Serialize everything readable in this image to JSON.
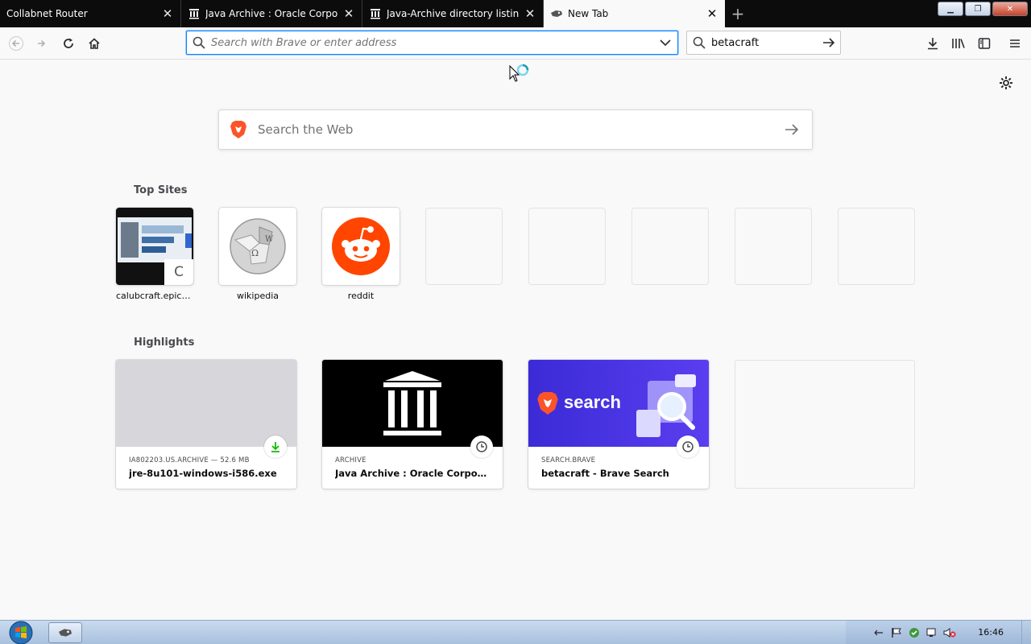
{
  "tabs": [
    {
      "title": "Collabnet Router",
      "icon": "none"
    },
    {
      "title": "Java Archive : Oracle Corporation",
      "icon": "archive-icon"
    },
    {
      "title": "Java-Archive directory listing",
      "icon": "archive-icon"
    },
    {
      "title": "New Tab",
      "icon": "brave-lion-icon"
    }
  ],
  "toolbar": {
    "url_placeholder": "Search with Brave or enter address",
    "search_value": "betacraft"
  },
  "newtab": {
    "websearch_placeholder": "Search the Web",
    "top_sites_title": "Top Sites",
    "highlights_title": "Highlights",
    "top_sites": [
      {
        "label": "calubcraft.epicg..."
      },
      {
        "label": "wikipedia"
      },
      {
        "label": "reddit"
      }
    ],
    "calub_thumb_text": "C",
    "highlights": [
      {
        "source": "IA802203.US.ARCHIVE — 52.6 MB",
        "title": "jre-8u101-windows-i586.exe",
        "badge": "download-icon"
      },
      {
        "source": "ARCHIVE",
        "title": "Java Archive : Oracle Corporatio...",
        "badge": "clock-icon"
      },
      {
        "source": "SEARCH.BRAVE",
        "title": "betacraft - Brave Search",
        "badge": "clock-icon",
        "image_text": "search"
      }
    ]
  },
  "taskbar": {
    "clock": "16:46"
  },
  "colors": {
    "accent": "#0a84ff",
    "reddit": "#ff4500",
    "brave": "#fb542b",
    "download_green": "#12bc00"
  }
}
